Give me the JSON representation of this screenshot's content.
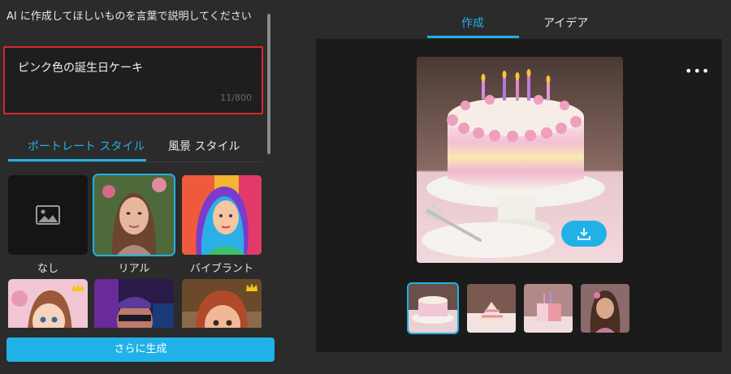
{
  "prompt": {
    "title": "AI に作成してほしいものを言葉で説明してください",
    "value": "ピンク色の誕生日ケーキ",
    "count": "11/800"
  },
  "style_tabs": [
    "ポートレート スタイル",
    "風景 スタイル"
  ],
  "styles": [
    {
      "label": "なし",
      "icon": "image-icon"
    },
    {
      "label": "リアル"
    },
    {
      "label": "バイブラント"
    },
    {
      "label": "",
      "premium": true
    },
    {
      "label": ""
    },
    {
      "label": "",
      "premium": true
    }
  ],
  "generate_label": "さらに生成",
  "top_tabs": [
    "作成",
    "アイデア"
  ],
  "more_label": "•••",
  "colors": {
    "accent": "#21b1e6",
    "highlight": "#d9262a"
  }
}
